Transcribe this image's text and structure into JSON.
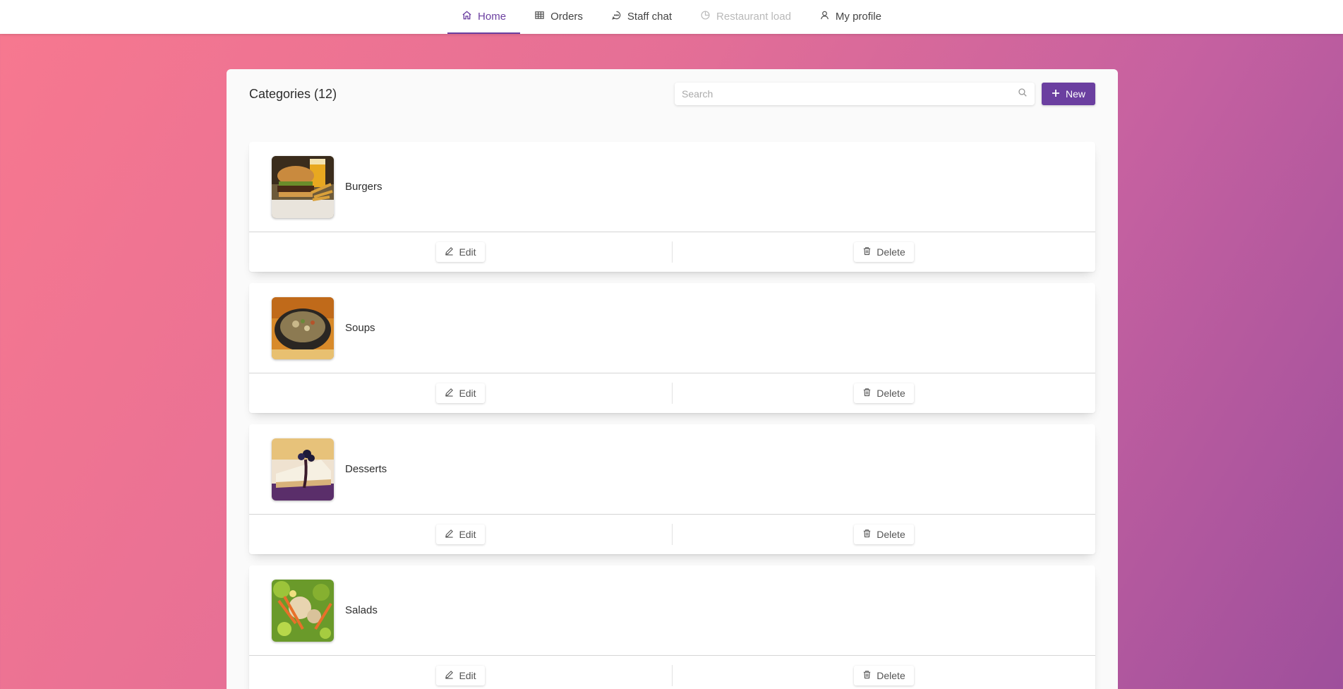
{
  "nav": {
    "items": [
      {
        "label": "Home",
        "icon": "home-icon",
        "state": "active"
      },
      {
        "label": "Orders",
        "icon": "table-icon",
        "state": "normal"
      },
      {
        "label": "Staff chat",
        "icon": "chat-icon",
        "state": "normal"
      },
      {
        "label": "Restaurant load",
        "icon": "pie-chart-icon",
        "state": "disabled"
      },
      {
        "label": "My profile",
        "icon": "user-icon",
        "state": "normal"
      }
    ]
  },
  "header": {
    "title": "Categories (12)",
    "search_placeholder": "Search",
    "search_value": "",
    "new_label": "New"
  },
  "categories": [
    {
      "name": "Burgers",
      "edit_label": "Edit",
      "delete_label": "Delete"
    },
    {
      "name": "Soups",
      "edit_label": "Edit",
      "delete_label": "Delete"
    },
    {
      "name": "Desserts",
      "edit_label": "Edit",
      "delete_label": "Delete"
    },
    {
      "name": "Salads",
      "edit_label": "Edit",
      "delete_label": "Delete"
    }
  ],
  "colors": {
    "accent": "#6b3fa0",
    "disabled_text": "#b9b9b9",
    "background_start": "#f7788f",
    "background_end": "#9e4f9c"
  }
}
